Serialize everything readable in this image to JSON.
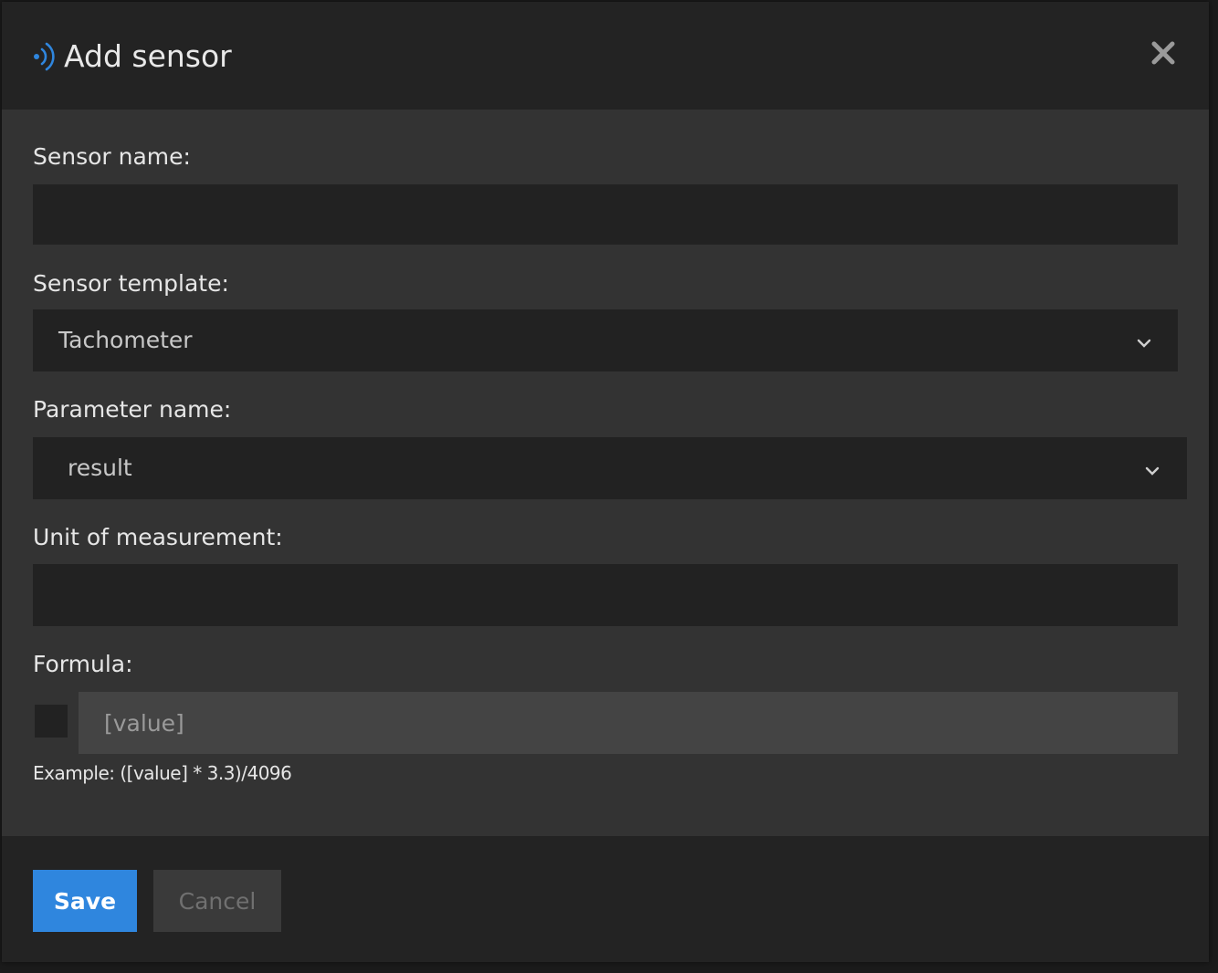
{
  "dialog": {
    "title": "Add sensor",
    "header_icon": "sensor-signal-icon",
    "close_icon": "close-icon",
    "accent_color": "#2f86de"
  },
  "form": {
    "sensor_name": {
      "label": "Sensor name:",
      "value": ""
    },
    "sensor_template": {
      "label": "Sensor template:",
      "selected": "Tachometer"
    },
    "parameter_name": {
      "label": "Parameter name:",
      "selected": "result"
    },
    "unit_of_measurement": {
      "label": "Unit of measurement:",
      "value": ""
    },
    "formula": {
      "label": "Formula:",
      "checkbox_checked": false,
      "placeholder": "[value]",
      "example": "Example: ([value] * 3.3)/4096"
    }
  },
  "footer": {
    "save_label": "Save",
    "cancel_label": "Cancel"
  }
}
